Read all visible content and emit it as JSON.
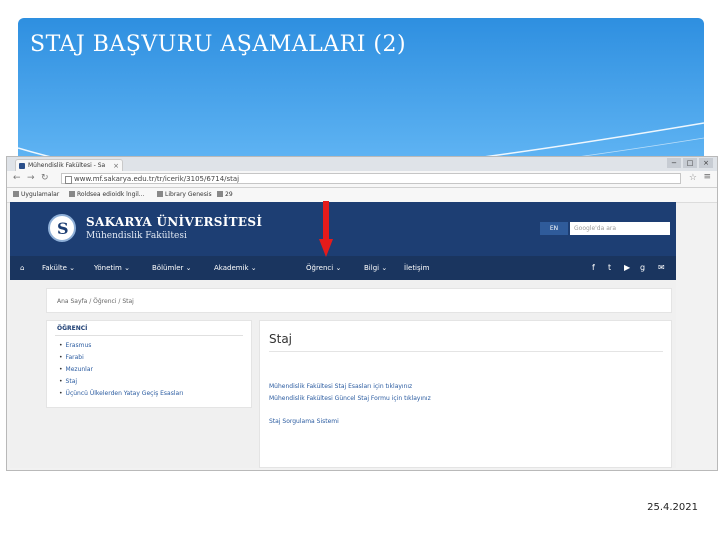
{
  "slide": {
    "title": "STAJ BAŞVURU AŞAMALARI (2)",
    "date": "25.4.2021"
  },
  "browser": {
    "tab_title": "Mühendislik Fakültesi - Sa",
    "tab_close": "×",
    "url": "www.mf.sakarya.edu.tr/tr/icerik/3105/6714/staj",
    "window_controls": [
      "−",
      "□",
      "×"
    ],
    "bookmarks": [
      "Uygulamalar",
      "Roldsea edioidk lngil...",
      "Library Genesis",
      "29"
    ]
  },
  "site": {
    "university": "SAKARYA ÜNİVERSİTESİ",
    "faculty": "Mühendislik Fakültesi",
    "lang_button": "EN",
    "search_placeholder": "Google'da ara",
    "nav": [
      "Fakülte",
      "Yönetim",
      "Bölümler",
      "Akademik",
      "Öğrenci",
      "Bilgi",
      "İletişim"
    ],
    "social_icons": [
      "facebook-icon",
      "twitter-icon",
      "youtube-icon",
      "google-plus-icon",
      "email-icon"
    ]
  },
  "breadcrumb": "Ana Sayfa  /  Öğrenci  /  Staj",
  "sidebar": {
    "title": "ÖĞRENCİ",
    "items": [
      "Erasmus",
      "Farabi",
      "Mezunlar",
      "Staj",
      "Üçüncü Ülkelerden Yatay Geçiş Esasları"
    ]
  },
  "main": {
    "title": "Staj",
    "links": [
      "Mühendislik Fakültesi Staj Esasları için tıklayınız",
      "Mühendislik Fakültesi Güncel Staj Formu için tıklayınız",
      "Staj Sorgulama Sistemi"
    ]
  },
  "colors": {
    "header": "#1d3e73",
    "nav": "#1a355f",
    "link": "#2a5ba0",
    "arrow": "#e51b1b"
  }
}
